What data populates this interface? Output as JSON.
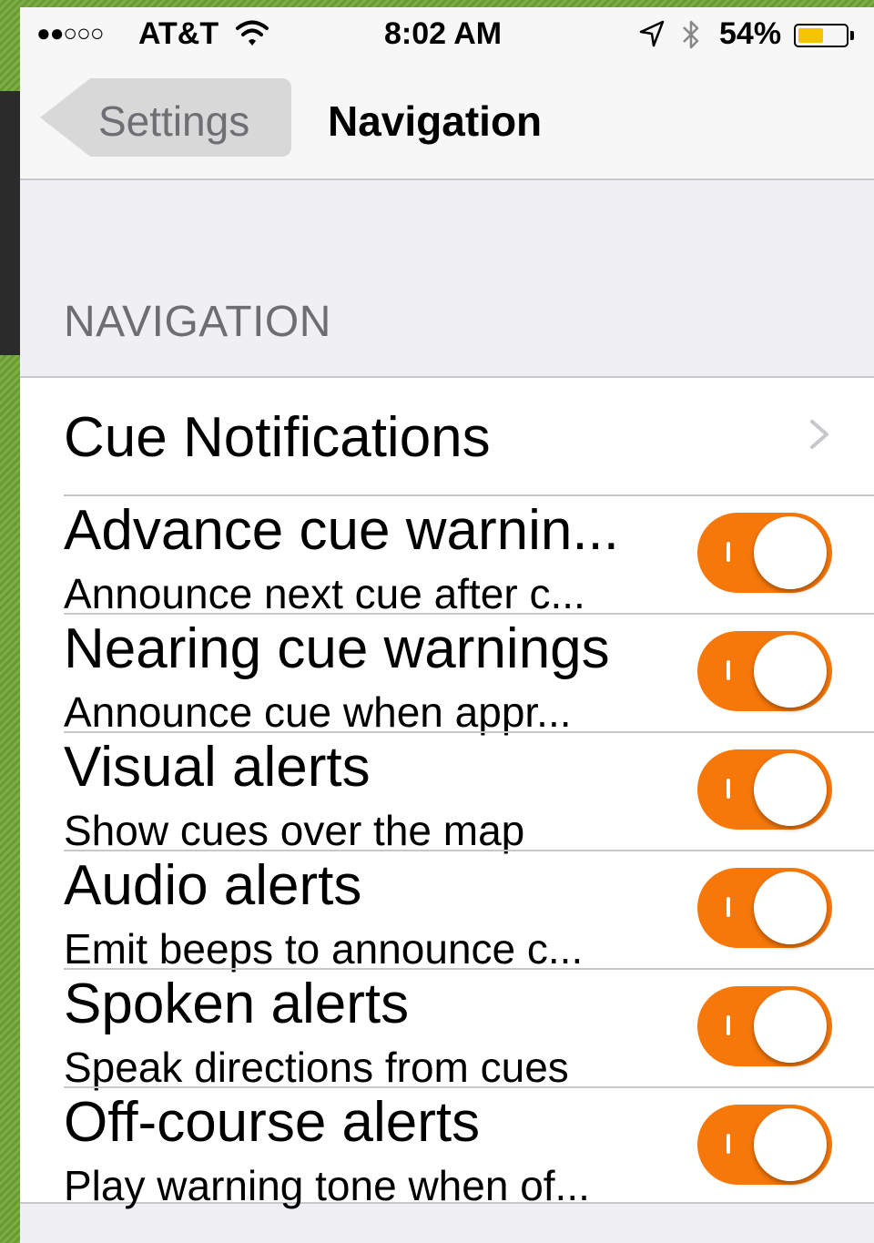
{
  "status_bar": {
    "signal": "●●○○○",
    "carrier": "AT&T",
    "time": "8:02 AM",
    "battery_percent": "54%",
    "battery_level": 0.54,
    "icons": [
      "wifi-icon",
      "location-arrow-icon",
      "bluetooth-icon",
      "battery-icon"
    ]
  },
  "nav": {
    "back_label": "Settings",
    "title": "Navigation"
  },
  "section": {
    "header": "NAVIGATION"
  },
  "rows": [
    {
      "title": "Cue Notifications",
      "type": "disclosure",
      "icon": "chevron-right-icon"
    },
    {
      "title": "Advance cue warnin...",
      "subtitle": "Announce next cue after c...",
      "type": "toggle",
      "on": true
    },
    {
      "title": "Nearing cue warnings",
      "subtitle": "Announce cue when appr...",
      "type": "toggle",
      "on": true
    },
    {
      "title": "Visual alerts",
      "subtitle": "Show cues over the map",
      "type": "toggle",
      "on": true
    },
    {
      "title": "Audio alerts",
      "subtitle": "Emit beeps to announce c...",
      "type": "toggle",
      "on": true
    },
    {
      "title": "Spoken alerts",
      "subtitle": "Speak directions from cues",
      "type": "toggle",
      "on": true
    },
    {
      "title": "Off-course alerts",
      "subtitle": "Play warning tone when of...",
      "type": "toggle",
      "on": true
    }
  ],
  "colors": {
    "accent": "#f7780a",
    "background": "#efeff4",
    "separator": "#c8c7cc"
  }
}
